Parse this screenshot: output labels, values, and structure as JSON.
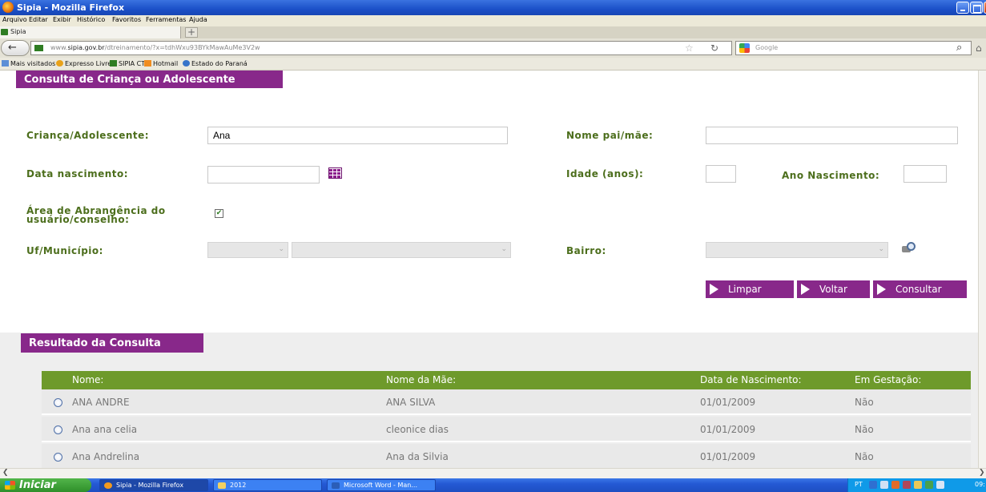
{
  "browser": {
    "window_title": "Sipia - Mozilla Firefox",
    "menu": [
      "Arquivo",
      "Editar",
      "Exibir",
      "Histórico",
      "Favoritos",
      "Ferramentas",
      "Ajuda"
    ],
    "tab_label": "Sipia",
    "new_tab": "+",
    "url_prefix": "www.",
    "url_domain": "sipia.gov.br",
    "url_path": "/dtreinamento/?x=tdhWxu93BYkMawAuMe3V2w",
    "search_engine": "Google",
    "bookmarks": [
      "Mais visitados",
      "Expresso Livre",
      "SIPIA CT",
      "Hotmail",
      "Estado do Paraná"
    ]
  },
  "form": {
    "section_title": "Consulta de Criança ou Adolescente",
    "child_label": "Criança/Adolescente:",
    "child_value": "Ana",
    "parent_label": "Nome pai/mãe:",
    "parent_value": "",
    "birth_label": "Data nascimento:",
    "birth_value": "",
    "age_label": "Idade (anos):",
    "age_value": "",
    "birth_year_label": "Ano Nascimento:",
    "birth_year_value": "",
    "area_label": "Área de Abrangência do usuário/conselho:",
    "area_checked": true,
    "uf_label": "Uf/Município:",
    "bairro_label": "Bairro:",
    "buttons": {
      "clear": "Limpar",
      "back": "Voltar",
      "search": "Consultar"
    }
  },
  "results": {
    "section_title": "Resultado da Consulta",
    "columns": [
      "Nome:",
      "Nome da Mãe:",
      "Data de Nascimento:",
      "Em Gestação:"
    ],
    "rows": [
      {
        "name": "ANA ANDRE",
        "mother": "ANA SILVA",
        "birth": "01/01/2009",
        "gestation": "Não"
      },
      {
        "name": "Ana ana celia",
        "mother": "cleonice dias",
        "birth": "01/01/2009",
        "gestation": "Não"
      },
      {
        "name": "Ana Andrelina",
        "mother": "Ana da Silvia",
        "birth": "01/01/2009",
        "gestation": "Não"
      }
    ]
  },
  "taskbar": {
    "start_label": "Iniciar",
    "tasks": [
      "Sipia - Mozilla Firefox",
      "2012",
      "Microsoft Word - Man..."
    ],
    "lang": "PT",
    "clock": "09:"
  },
  "colors": {
    "accent_purple": "#88288a",
    "label_green": "#4c6e1c",
    "table_header_green": "#6e9a2b"
  }
}
